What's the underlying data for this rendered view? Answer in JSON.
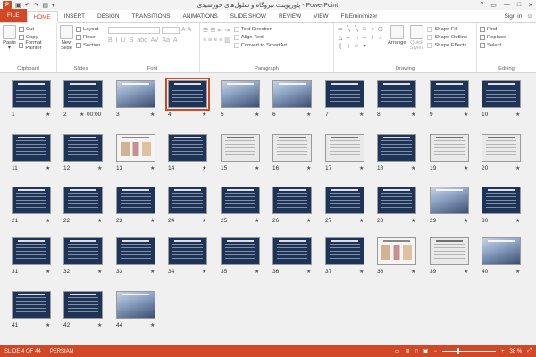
{
  "window": {
    "title": "پاورپوینت نیروگاه و سلول‌های خورشیدی - PowerPoint",
    "app_icon_label": "P",
    "controls": [
      "?",
      "▭",
      "—",
      "□",
      "✕"
    ]
  },
  "tabs": {
    "file": "FILE",
    "items": [
      "HOME",
      "INSERT",
      "DESIGN",
      "TRANSITIONS",
      "ANIMATIONS",
      "SLIDE SHOW",
      "REVIEW",
      "VIEW",
      "FILEminimizer"
    ],
    "active": "HOME",
    "sign_in": "Sign in"
  },
  "ribbon": {
    "clipboard": {
      "label": "Clipboard",
      "paste": "Paste",
      "cut": "Cut",
      "copy": "Copy",
      "format_painter": "Format Painter"
    },
    "slides": {
      "label": "Slides",
      "new_slide_1": "New",
      "new_slide_2": "Slide",
      "layout": "Layout",
      "reset": "Reset",
      "section": "Section"
    },
    "font": {
      "label": "Font"
    },
    "paragraph": {
      "label": "Paragraph",
      "text_direction": "Text Direction",
      "align_text": "Align Text",
      "convert_smartart": "Convert to SmartArt"
    },
    "drawing": {
      "label": "Drawing",
      "arrange": "Arrange",
      "quick_styles_1": "Quick",
      "quick_styles_2": "Styles",
      "shape_fill": "Shape Fill",
      "shape_outline": "Shape Outline",
      "shape_effects": "Shape Effects"
    },
    "editing": {
      "label": "Editing",
      "find": "Find",
      "replace": "Replace",
      "select": "Select"
    }
  },
  "slides": {
    "selected": 4,
    "items": [
      {
        "n": "1"
      },
      {
        "n": "2",
        "extra": "00:00"
      },
      {
        "n": "3"
      },
      {
        "n": "4"
      },
      {
        "n": "5"
      },
      {
        "n": "6"
      },
      {
        "n": "7"
      },
      {
        "n": "8"
      },
      {
        "n": "9"
      },
      {
        "n": "10"
      },
      {
        "n": "11"
      },
      {
        "n": "12"
      },
      {
        "n": "13"
      },
      {
        "n": "14"
      },
      {
        "n": "15"
      },
      {
        "n": "16"
      },
      {
        "n": "17"
      },
      {
        "n": "18"
      },
      {
        "n": "19"
      },
      {
        "n": "20"
      },
      {
        "n": "21"
      },
      {
        "n": "22"
      },
      {
        "n": "23"
      },
      {
        "n": "24"
      },
      {
        "n": "25"
      },
      {
        "n": "26"
      },
      {
        "n": "27"
      },
      {
        "n": "28"
      },
      {
        "n": "29"
      },
      {
        "n": "30"
      },
      {
        "n": "31"
      },
      {
        "n": "32"
      },
      {
        "n": "33"
      },
      {
        "n": "34"
      },
      {
        "n": "35"
      },
      {
        "n": "36"
      },
      {
        "n": "37"
      },
      {
        "n": "38"
      },
      {
        "n": "39"
      },
      {
        "n": "40"
      },
      {
        "n": "41"
      },
      {
        "n": "42"
      },
      {
        "n": "44"
      }
    ]
  },
  "status": {
    "slide_info": "SLIDE 4 OF 44",
    "language": "PERSIAN",
    "zoom": "38 %"
  },
  "colors": {
    "accent": "#d24726",
    "slide_bg": "#1d3358"
  }
}
